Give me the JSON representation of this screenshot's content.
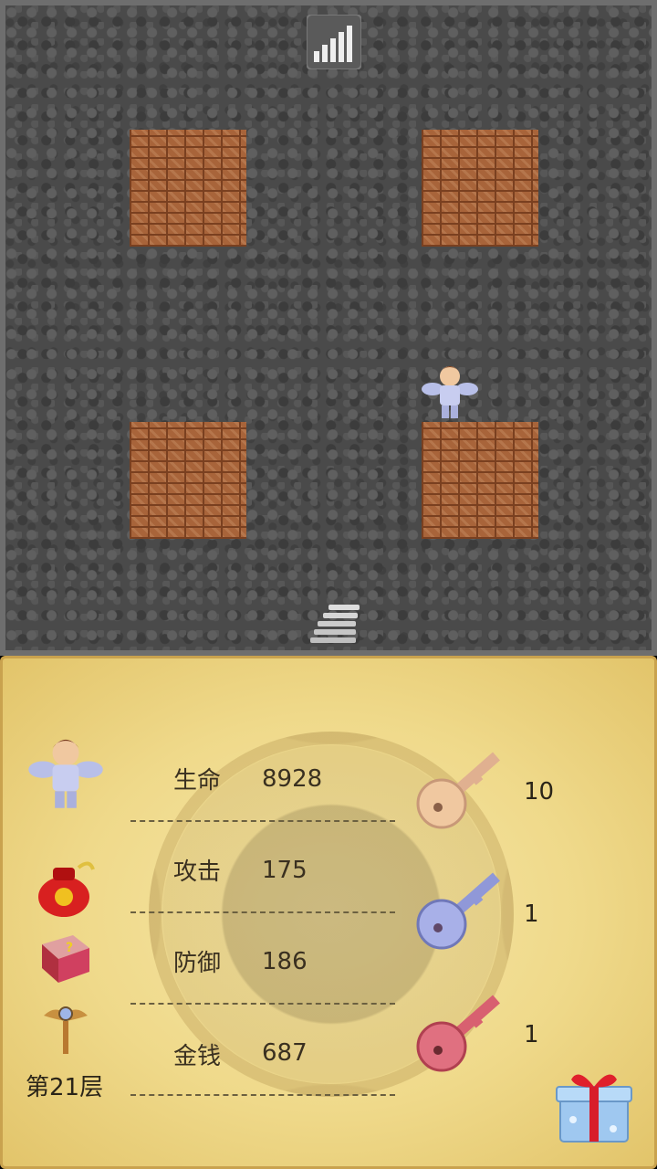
{
  "map": {
    "tiles": [
      "brick-wall",
      "brick-wall",
      "brick-wall",
      "brick-wall"
    ],
    "stairs_up": "stairs-up-icon",
    "stairs_down": "stairs-down-icon",
    "hero": "hero-sprite"
  },
  "status": {
    "hp_label": "生命",
    "hp_value": "8928",
    "atk_label": "攻击",
    "atk_value": "175",
    "def_label": "防御",
    "def_value": "186",
    "gold_label": "金钱",
    "gold_value": "687",
    "floor_label": "第21层"
  },
  "keys": {
    "yellow_count": "10",
    "blue_count": "1",
    "red_count": "1"
  },
  "colors": {
    "panel_bg": "#efd98a",
    "wall": "#4a4a4a",
    "brick": "#a8643a"
  }
}
